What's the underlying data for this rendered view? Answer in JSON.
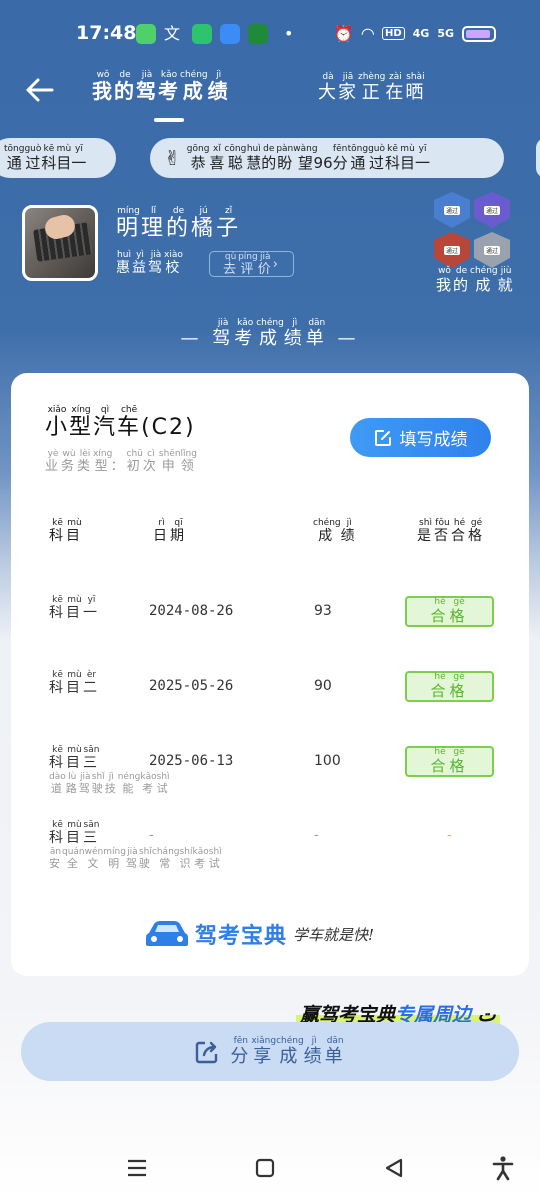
{
  "status": {
    "time": "17:48",
    "network": "5G",
    "network2": "4G",
    "hd": "HD"
  },
  "header": {
    "title_chars": [
      {
        "c": "我",
        "p": "wǒ"
      },
      {
        "c": "的",
        "p": "de"
      },
      {
        "c": "驾",
        "p": "jià"
      },
      {
        "c": "考",
        "p": "kǎo"
      },
      {
        "c": "成",
        "p": "chéng"
      },
      {
        "c": "绩",
        "p": "jì"
      }
    ],
    "tab2_chars": [
      {
        "c": "大",
        "p": "dà"
      },
      {
        "c": "家",
        "p": "jiā"
      },
      {
        "c": "正",
        "p": "zhèng"
      },
      {
        "c": "在",
        "p": "zài"
      },
      {
        "c": "晒",
        "p": "shài"
      }
    ]
  },
  "marquee": {
    "item1_chars": [
      {
        "c": "通",
        "p": "tōng"
      },
      {
        "c": "过",
        "p": "guò"
      },
      {
        "c": "科",
        "p": "kē"
      },
      {
        "c": "目",
        "p": "mù"
      },
      {
        "c": "一",
        "p": "yī"
      }
    ],
    "item2_chars": [
      {
        "c": "恭",
        "p": "gōng"
      },
      {
        "c": "喜",
        "p": "xǐ"
      },
      {
        "c": "聪",
        "p": "cōng"
      },
      {
        "c": "慧",
        "p": "huì"
      },
      {
        "c": "的",
        "p": "de"
      },
      {
        "c": "盼",
        "p": "pàn"
      },
      {
        "c": "望",
        "p": "wàng"
      },
      {
        "c": "96",
        "p": ""
      },
      {
        "c": "分",
        "p": "fēn"
      },
      {
        "c": "通",
        "p": "tōng"
      },
      {
        "c": "过",
        "p": "guò"
      },
      {
        "c": "科",
        "p": "kē"
      },
      {
        "c": "目",
        "p": "mù"
      },
      {
        "c": "一",
        "p": "yī"
      }
    ],
    "hand_emoji": "✌"
  },
  "profile": {
    "name_chars": [
      {
        "c": "明",
        "p": "míng"
      },
      {
        "c": "理",
        "p": "lǐ"
      },
      {
        "c": "的",
        "p": "de"
      },
      {
        "c": "橘",
        "p": "jú"
      },
      {
        "c": "子",
        "p": "zǐ"
      }
    ],
    "school_chars": [
      {
        "c": "惠",
        "p": "huì"
      },
      {
        "c": "益",
        "p": "yì"
      },
      {
        "c": "驾",
        "p": "jià"
      },
      {
        "c": "校",
        "p": "xiào"
      }
    ],
    "rate_chars": [
      {
        "c": "去",
        "p": "qù"
      },
      {
        "c": "评",
        "p": "píng"
      },
      {
        "c": "价",
        "p": "jià"
      },
      {
        "c": "›",
        "p": ""
      }
    ],
    "badges": [
      {
        "label": "通过",
        "color": "#4a7fd0"
      },
      {
        "label": "通过",
        "color": "#6a5ccf"
      },
      {
        "label": "通过",
        "color": "#b8473a"
      },
      {
        "label": "通过",
        "color": "#9aa3ad"
      }
    ],
    "achv_chars": [
      {
        "c": "我",
        "p": "wǒ"
      },
      {
        "c": "的",
        "p": "de"
      },
      {
        "c": "成",
        "p": "chéng"
      },
      {
        "c": "就",
        "p": "jiù"
      }
    ]
  },
  "section": {
    "title_chars": [
      {
        "c": "—  ",
        "p": ""
      },
      {
        "c": "驾",
        "p": "jià"
      },
      {
        "c": "考",
        "p": "kǎo"
      },
      {
        "c": "成",
        "p": "chéng"
      },
      {
        "c": "绩",
        "p": "jì"
      },
      {
        "c": "单",
        "p": "dān"
      },
      {
        "c": "  —",
        "p": ""
      }
    ]
  },
  "card": {
    "car_chars": [
      {
        "c": "小",
        "p": "xiǎo"
      },
      {
        "c": "型",
        "p": "xíng"
      },
      {
        "c": "汽",
        "p": "qì"
      },
      {
        "c": "车",
        "p": "chē"
      },
      {
        "c": "(C2)",
        "p": ""
      }
    ],
    "biz_chars": [
      {
        "c": "业",
        "p": "yè"
      },
      {
        "c": "务",
        "p": "wù"
      },
      {
        "c": "类",
        "p": "lèi"
      },
      {
        "c": "型",
        "p": "xíng"
      },
      {
        "c": "：",
        "p": ""
      },
      {
        "c": "初",
        "p": "chū"
      },
      {
        "c": "次",
        "p": "cì"
      },
      {
        "c": "申",
        "p": "shēn"
      },
      {
        "c": "领",
        "p": "lǐng"
      }
    ],
    "fill_button": "填写成绩",
    "headers": {
      "subject": [
        {
          "c": "科",
          "p": "kē"
        },
        {
          "c": "目",
          "p": "mù"
        }
      ],
      "date": [
        {
          "c": "日",
          "p": "rì"
        },
        {
          "c": "期",
          "p": "qī"
        }
      ],
      "score": [
        {
          "c": "成",
          "p": "chéng"
        },
        {
          "c": "绩",
          "p": "jì"
        }
      ],
      "pass": [
        {
          "c": "是",
          "p": "shì"
        },
        {
          "c": "否",
          "p": "fǒu"
        },
        {
          "c": "合",
          "p": "hé"
        },
        {
          "c": "格",
          "p": "gé"
        }
      ]
    },
    "pass_chars": [
      {
        "c": "合",
        "p": "hé"
      },
      {
        "c": "格",
        "p": "gé"
      }
    ],
    "rows": [
      {
        "subject": [
          {
            "c": "科",
            "p": "kē"
          },
          {
            "c": "目",
            "p": "mù"
          },
          {
            "c": "一",
            "p": "yī"
          }
        ],
        "sub": [],
        "date": "2024-08-26",
        "score": "93",
        "passed": true
      },
      {
        "subject": [
          {
            "c": "科",
            "p": "kē"
          },
          {
            "c": "目",
            "p": "mù"
          },
          {
            "c": "二",
            "p": "èr"
          }
        ],
        "sub": [],
        "date": "2025-05-26",
        "score": "90",
        "passed": true
      },
      {
        "subject": [
          {
            "c": "科",
            "p": "kē"
          },
          {
            "c": "目",
            "p": "mù"
          },
          {
            "c": "三",
            "p": "sān"
          }
        ],
        "sub": [
          {
            "c": "道",
            "p": "dào"
          },
          {
            "c": "路",
            "p": "lù"
          },
          {
            "c": "驾",
            "p": "jià"
          },
          {
            "c": "驶",
            "p": "shǐ"
          },
          {
            "c": "技",
            "p": "jì"
          },
          {
            "c": "能",
            "p": "néng"
          },
          {
            "c": "考",
            "p": "kǎo"
          },
          {
            "c": "试",
            "p": "shì"
          }
        ],
        "date": "2025-06-13",
        "score": "100",
        "passed": true
      },
      {
        "subject": [
          {
            "c": "科",
            "p": "kē"
          },
          {
            "c": "目",
            "p": "mù"
          },
          {
            "c": "三",
            "p": "sān"
          }
        ],
        "sub": [
          {
            "c": "安",
            "p": "ān"
          },
          {
            "c": "全",
            "p": "quán"
          },
          {
            "c": "文",
            "p": "wén"
          },
          {
            "c": "明",
            "p": "míng"
          },
          {
            "c": "驾",
            "p": "jià"
          },
          {
            "c": "驶",
            "p": "shǐ"
          },
          {
            "c": "常",
            "p": "cháng"
          },
          {
            "c": "识",
            "p": "shí"
          },
          {
            "c": "考",
            "p": "kǎo"
          },
          {
            "c": "试",
            "p": "shì"
          }
        ],
        "date": "-",
        "score": "-",
        "passed": false,
        "pass_text": "-"
      }
    ],
    "brand_name": "驾考宝典",
    "brand_slogan": "学车就是快!"
  },
  "promo": {
    "prefix": "赢驾考宝典",
    "emphasis": "专属周边",
    "suffix": " ت"
  },
  "share": {
    "chars": [
      {
        "c": "分",
        "p": "fēn"
      },
      {
        "c": "享",
        "p": "xiǎng"
      },
      {
        "c": "成",
        "p": "chéng"
      },
      {
        "c": "绩",
        "p": "jì"
      },
      {
        "c": "单",
        "p": "dān"
      }
    ]
  },
  "colors": {
    "header_blue": "#3a6aa8",
    "accent_blue": "#2f82ec",
    "pass_green": "#59b52e",
    "pending_orange": "#f5a05a"
  }
}
